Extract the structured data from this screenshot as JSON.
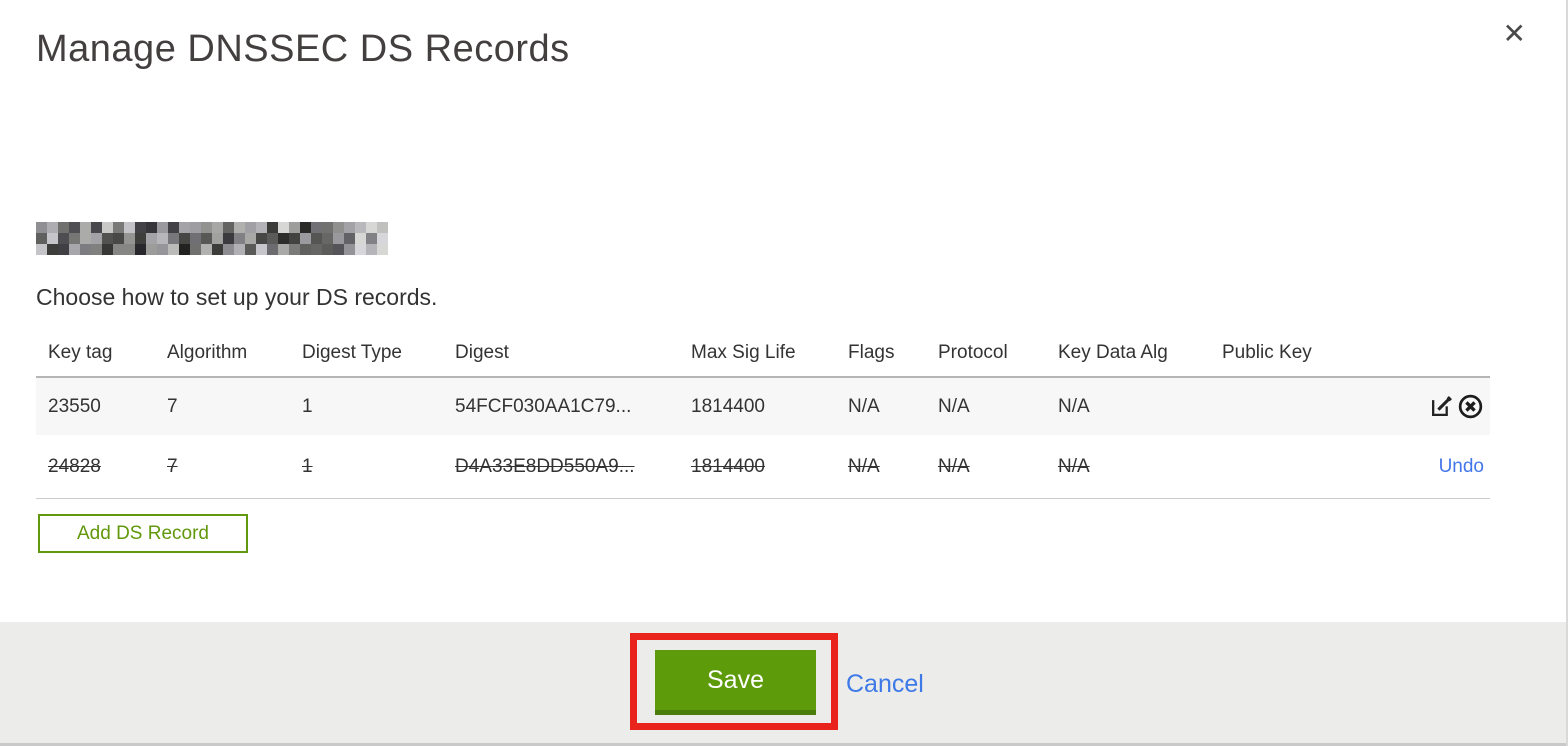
{
  "modal": {
    "title": "Manage DNSSEC DS Records",
    "close_glyph": "✕",
    "domain_redacted": true,
    "intro": "Choose how to set up your DS records.",
    "table": {
      "headers": [
        "Key tag",
        "Algorithm",
        "Digest Type",
        "Digest",
        "Max Sig Life",
        "Flags",
        "Protocol",
        "Key Data Alg",
        "Public Key"
      ],
      "rows": [
        {
          "key_tag": "23550",
          "algorithm": "7",
          "digest_type": "1",
          "digest": "54FCF030AA1C79...",
          "max_sig_life": "1814400",
          "flags": "N/A",
          "protocol": "N/A",
          "key_data_alg": "N/A",
          "public_key": "",
          "state": "normal"
        },
        {
          "key_tag": "24828",
          "algorithm": "7",
          "digest_type": "1",
          "digest": "D4A33E8DD550A9...",
          "max_sig_life": "1814400",
          "flags": "N/A",
          "protocol": "N/A",
          "key_data_alg": "N/A",
          "public_key": "",
          "state": "deleted",
          "undo_label": "Undo"
        }
      ]
    },
    "add_button_label": "Add DS Record",
    "footer": {
      "save_label": "Save",
      "cancel_label": "Cancel"
    }
  },
  "colors": {
    "button_green": "#5d9b0a",
    "outline_green": "#61980d",
    "link_blue": "#3e79e8",
    "annotation_red": "#e9241d",
    "row_stripe": "#f7f7f7",
    "footer_bg": "#ececea"
  }
}
